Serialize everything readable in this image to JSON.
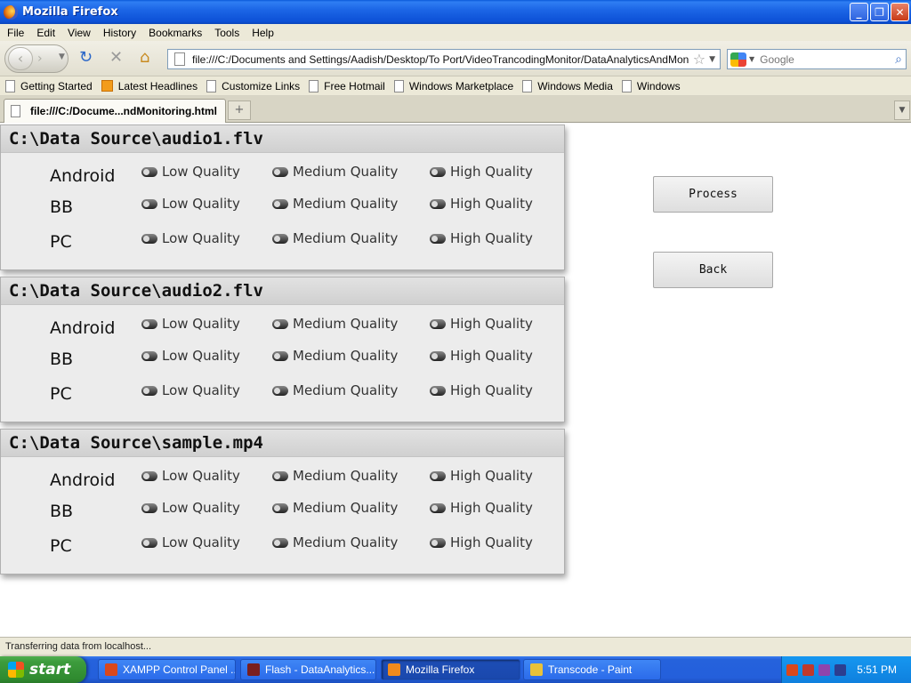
{
  "window": {
    "title": "Mozilla Firefox",
    "controls": {
      "minimize": "_",
      "maximize": "❐",
      "close": "✕"
    }
  },
  "menu": [
    "File",
    "Edit",
    "View",
    "History",
    "Bookmarks",
    "Tools",
    "Help"
  ],
  "nav": {
    "url": "file:///C:/Documents and Settings/Aadish/Desktop/To Port/VideoTrancodingMonitor/DataAnalyticsAndMonitoring_M",
    "search_placeholder": "Google"
  },
  "bookmarks": [
    "Getting Started",
    "Latest Headlines",
    "Customize Links",
    "Free Hotmail",
    "Windows Marketplace",
    "Windows Media",
    "Windows"
  ],
  "tab": {
    "title": "file:///C:/Docume...ndMonitoring.html",
    "new_tab": "+"
  },
  "panels": [
    {
      "title": "C:\\Data Source\\audio1.flv",
      "rows": [
        {
          "device": "Android",
          "options": [
            "Low Quality",
            "Medium Quality",
            "High Quality"
          ]
        },
        {
          "device": "BB",
          "options": [
            "Low Quality",
            "Medium Quality",
            "High Quality"
          ]
        },
        {
          "device": "PC",
          "options": [
            "Low Quality",
            "Medium Quality",
            "High Quality"
          ]
        }
      ]
    },
    {
      "title": "C:\\Data Source\\audio2.flv",
      "rows": [
        {
          "device": "Android",
          "options": [
            "Low Quality",
            "Medium Quality",
            "High Quality"
          ]
        },
        {
          "device": "BB",
          "options": [
            "Low Quality",
            "Medium Quality",
            "High Quality"
          ]
        },
        {
          "device": "PC",
          "options": [
            "Low Quality",
            "Medium Quality",
            "High Quality"
          ]
        }
      ]
    },
    {
      "title": "C:\\Data Source\\sample.mp4",
      "rows": [
        {
          "device": "Android",
          "options": [
            "Low Quality",
            "Medium Quality",
            "High Quality"
          ]
        },
        {
          "device": "BB",
          "options": [
            "Low Quality",
            "Medium Quality",
            "High Quality"
          ]
        },
        {
          "device": "PC",
          "options": [
            "Low Quality",
            "Medium Quality",
            "High Quality"
          ]
        }
      ]
    }
  ],
  "buttons": {
    "process": "Process",
    "back": "Back"
  },
  "status": "Transferring data from localhost...",
  "taskbar": {
    "start": "start",
    "tasks": [
      {
        "label": "XAMPP Control Panel ...",
        "icon_color": "#d9481c",
        "active": false
      },
      {
        "label": "Flash - DataAnalytics...",
        "icon_color": "#7a1f1f",
        "active": false
      },
      {
        "label": "Mozilla Firefox",
        "icon_color": "#f08a1c",
        "active": true
      },
      {
        "label": "Transcode - Paint",
        "icon_color": "#e8c23a",
        "active": false
      }
    ],
    "clock": "5:51 PM"
  }
}
